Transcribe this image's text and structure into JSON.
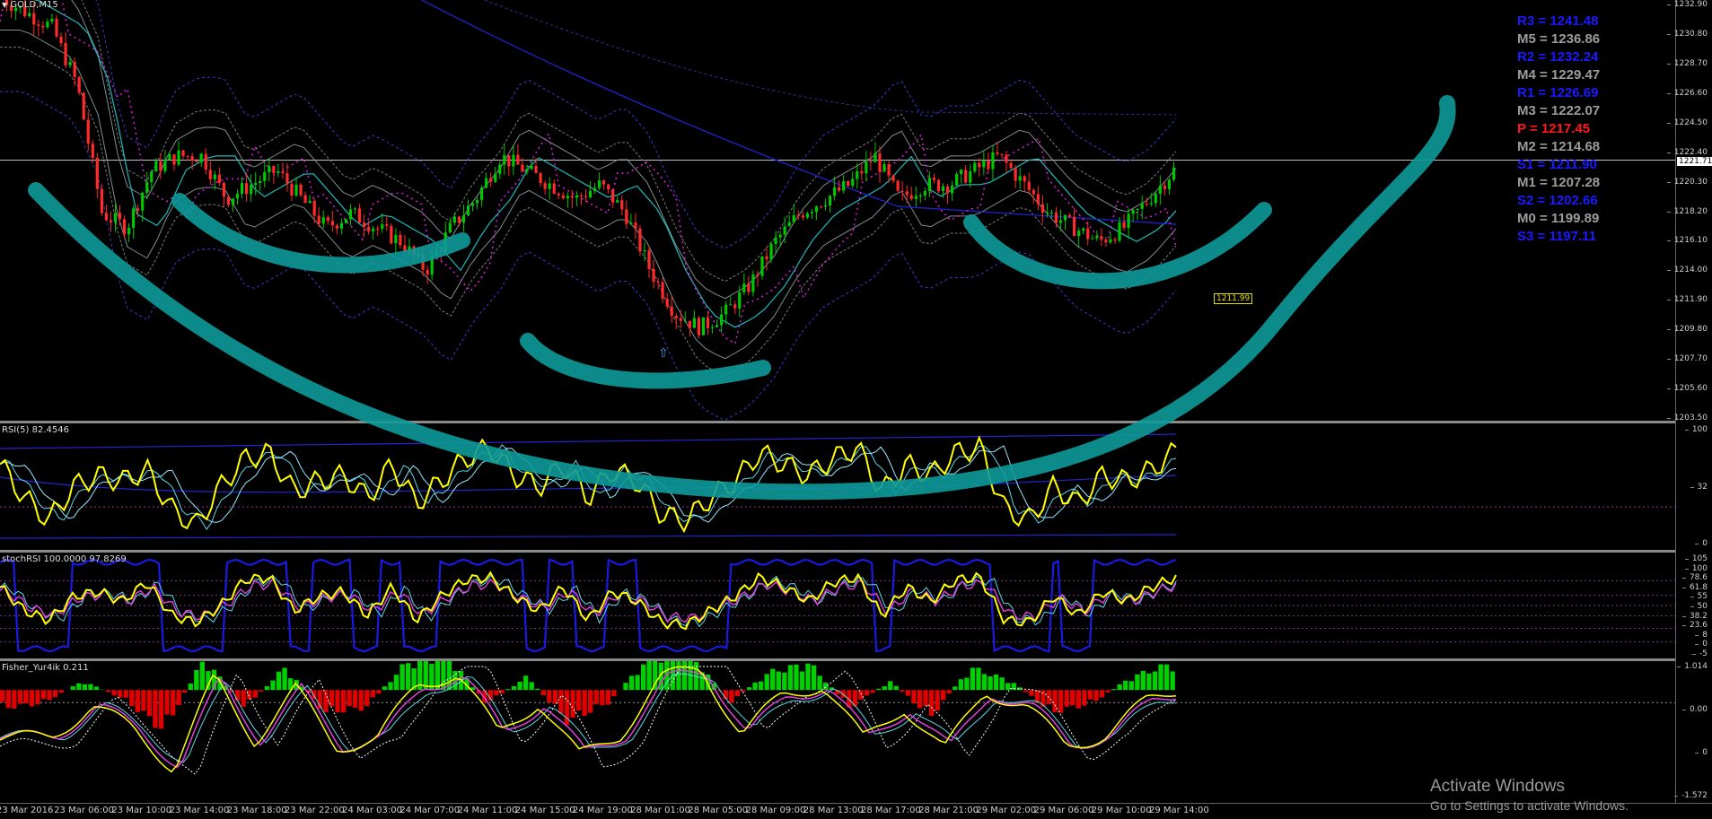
{
  "window": {
    "symbol_label": "GOLD,M15"
  },
  "pivots": [
    {
      "label": "R3 = 1241.48",
      "color": "#1a1aff"
    },
    {
      "label": "M5 = 1236.86",
      "color": "#9c9c9c"
    },
    {
      "label": "R2 = 1232.24",
      "color": "#1a1aff"
    },
    {
      "label": "M4 = 1229.47",
      "color": "#9c9c9c"
    },
    {
      "label": "R1 = 1226.69",
      "color": "#1a1aff"
    },
    {
      "label": "M3 = 1222.07",
      "color": "#9c9c9c"
    },
    {
      "label": "P   = 1217.45",
      "color": "#ff1a1a"
    },
    {
      "label": "M2 = 1214.68",
      "color": "#9c9c9c"
    },
    {
      "label": "S1 = 1211.90",
      "color": "#1a1aff"
    },
    {
      "label": "M1 = 1207.28",
      "color": "#9c9c9c"
    },
    {
      "label": "S2 = 1202.66",
      "color": "#1a1aff"
    },
    {
      "label": "M0 = 1199.89",
      "color": "#9c9c9c"
    },
    {
      "label": "S3 = 1197.11",
      "color": "#1a1aff"
    }
  ],
  "price_axis": {
    "ticks": [
      "1232.90",
      "1230.80",
      "1228.70",
      "1226.60",
      "1224.50",
      "1222.40",
      "1220.30",
      "1218.20",
      "1216.10",
      "1214.00",
      "1211.90",
      "1209.80",
      "1207.70",
      "1205.60",
      "1203.50"
    ],
    "current_price": "1221.71",
    "marker_price": "1211.99"
  },
  "rsi_pane": {
    "label": "RSI(5) 82.4546",
    "ticks": [
      "100",
      "32",
      "0"
    ]
  },
  "stoch_pane": {
    "label": "stochRSI 100.0000 97.8269",
    "ticks": [
      "105",
      "100",
      "78.6",
      "61.8",
      "55",
      "50",
      "38.2",
      "23.6",
      "8",
      "0",
      "-5"
    ]
  },
  "fisher_pane": {
    "label": "Fisher_Yur4ik 0.211",
    "ticks": [
      "1.014",
      "0.00",
      "0",
      "-1.572"
    ]
  },
  "time_axis": {
    "labels": [
      "23 Mar 2016",
      "23 Mar 06:00",
      "23 Mar 10:00",
      "23 Mar 14:00",
      "23 Mar 18:00",
      "23 Mar 22:00",
      "24 Mar 03:00",
      "24 Mar 07:00",
      "24 Mar 11:00",
      "24 Mar 15:00",
      "24 Mar 19:00",
      "28 Mar 01:00",
      "28 Mar 05:00",
      "28 Mar 09:00",
      "28 Mar 13:00",
      "28 Mar 17:00",
      "28 Mar 21:00",
      "29 Mar 02:00",
      "29 Mar 06:00",
      "29 Mar 10:00",
      "29 Mar 14:00"
    ]
  },
  "watermark": {
    "title": "Activate Windows",
    "subtitle": "Go to Settings to activate Windows."
  },
  "colors": {
    "bull_candle": "#00c800",
    "bear_candle": "#ff2a2a",
    "rsi_line": "#ffff00",
    "annotation": "#0e9a9a",
    "histogram_pos": "#00d000",
    "histogram_neg": "#e00000"
  },
  "chart_data": [
    {
      "type": "candlestick",
      "title": "GOLD,M15",
      "ylim": [
        1203.5,
        1232.9
      ],
      "price_line": 1221.71,
      "close_path": [
        1233,
        1232,
        1231,
        1227,
        1218,
        1217,
        1221,
        1222,
        1222,
        1219,
        1220,
        1221,
        1219,
        1217,
        1218,
        1217,
        1216,
        1214,
        1217,
        1219,
        1222,
        1221,
        1220,
        1219,
        1220,
        1218,
        1214,
        1211,
        1210,
        1211,
        1213,
        1216,
        1218,
        1219,
        1220,
        1222,
        1219,
        1220,
        1220,
        1221,
        1222,
        1220,
        1218,
        1217,
        1216,
        1217,
        1219,
        1221
      ]
    },
    {
      "type": "line",
      "title": "RSI(5) 82.4546",
      "ylim": [
        0,
        100
      ],
      "level": 32,
      "values": [
        70,
        40,
        20,
        50,
        60,
        55,
        65,
        30,
        15,
        50,
        75,
        80,
        45,
        55,
        60,
        40,
        70,
        35,
        55,
        75,
        85,
        60,
        50,
        70,
        40,
        65,
        55,
        25,
        20,
        40,
        55,
        80,
        70,
        60,
        75,
        85,
        45,
        70,
        60,
        80,
        85,
        30,
        20,
        50,
        35,
        60,
        55,
        65,
        82
      ]
    },
    {
      "type": "line",
      "title": "stochRSI 100.0000 97.8269",
      "ylim": [
        -5,
        105
      ],
      "levels": [
        78.6,
        61.8,
        50,
        38.2,
        23.6,
        8
      ],
      "values": [
        80,
        30,
        10,
        60,
        70,
        50,
        90,
        20,
        5,
        40,
        95,
        100,
        30,
        60,
        70,
        20,
        80,
        10,
        60,
        95,
        100,
        60,
        30,
        80,
        10,
        70,
        50,
        5,
        0,
        30,
        60,
        100,
        80,
        50,
        90,
        100,
        20,
        80,
        50,
        95,
        100,
        10,
        5,
        60,
        20,
        70,
        50,
        80,
        100
      ]
    },
    {
      "type": "bar",
      "title": "Fisher_Yur4ik 0.211",
      "ylim": [
        -1.572,
        1.014
      ],
      "values": [
        -0.4,
        -0.3,
        0.2,
        -0.2,
        -0.9,
        0.7,
        -0.4,
        0.5,
        -0.5,
        -0.4,
        0.6,
        0.8,
        -0.3,
        0.3,
        -0.7,
        -0.3,
        0.7,
        0.9,
        -0.3,
        0.4,
        0.6,
        -0.4,
        0.2,
        -0.6,
        0.5,
        0.2,
        -0.5,
        -0.3,
        0.3,
        0.6
      ]
    }
  ]
}
